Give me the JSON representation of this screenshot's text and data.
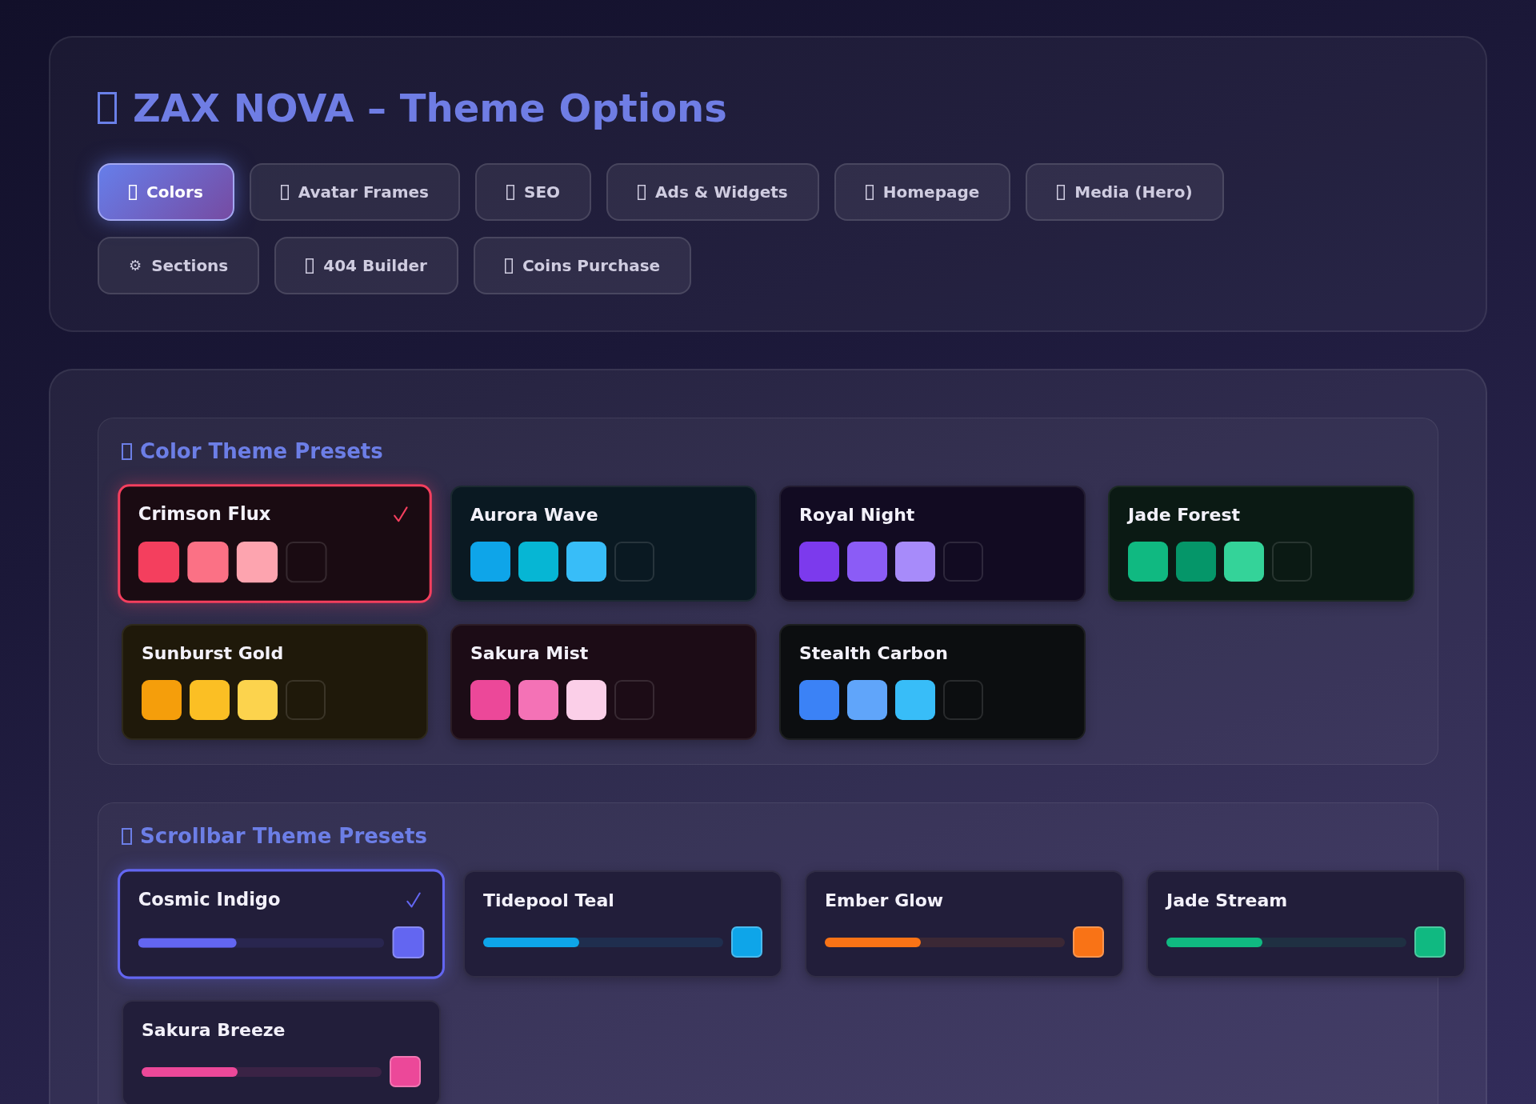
{
  "header": {
    "title": "ZAX NOVA – Theme Options"
  },
  "tabs": [
    {
      "label": "Colors",
      "selected": true
    },
    {
      "label": "Avatar Frames",
      "selected": false
    },
    {
      "label": "SEO",
      "selected": false
    },
    {
      "label": "Ads & Widgets",
      "selected": false
    },
    {
      "label": "Homepage",
      "selected": false
    },
    {
      "label": "Media (Hero)",
      "selected": false
    },
    {
      "label": "Sections",
      "selected": false,
      "glyph": "⚙"
    },
    {
      "label": "404 Builder",
      "selected": false
    },
    {
      "label": "Coins Purchase",
      "selected": false
    }
  ],
  "color_presets": {
    "heading": "Color Theme Presets",
    "items": [
      {
        "name": "Crimson Flux",
        "selected": true,
        "swatches": [
          {
            "color": "#f43f5e"
          },
          {
            "color": "#fb7185"
          },
          {
            "color": "#fda4af"
          },
          {
            "color": "#1a0b12"
          }
        ]
      },
      {
        "name": "Aurora Wave",
        "selected": false,
        "swatches": [
          {
            "color": "#0ea5e9"
          },
          {
            "color": "#06b6d4"
          },
          {
            "color": "#38bdf8"
          },
          {
            "color": "#0a1922"
          }
        ]
      },
      {
        "name": "Royal Night",
        "selected": false,
        "swatches": [
          {
            "color": "#7c3aed"
          },
          {
            "color": "#8b5cf6"
          },
          {
            "color": "#a78bfa"
          },
          {
            "color": "#120b22"
          }
        ]
      },
      {
        "name": "Jade Forest",
        "selected": false,
        "swatches": [
          {
            "color": "#10b981"
          },
          {
            "color": "#059669"
          },
          {
            "color": "#34d399"
          },
          {
            "color": "#0b1a14"
          }
        ]
      },
      {
        "name": "Sunburst Gold",
        "selected": false,
        "swatches": [
          {
            "color": "#f59e0b"
          },
          {
            "color": "#fbbf24"
          },
          {
            "color": "#fcd34d"
          },
          {
            "color": "#1f190a"
          }
        ]
      },
      {
        "name": "Sakura Mist",
        "selected": false,
        "swatches": [
          {
            "color": "#ec4899"
          },
          {
            "color": "#f472b6"
          },
          {
            "color": "#fbcfe8"
          },
          {
            "color": "#1c0c16"
          }
        ]
      },
      {
        "name": "Stealth Carbon",
        "selected": false,
        "swatches": [
          {
            "color": "#3b82f6"
          },
          {
            "color": "#60a5fa"
          },
          {
            "color": "#38bdf8"
          },
          {
            "color": "#0c0e10"
          }
        ]
      }
    ]
  },
  "scrollbar_presets": {
    "heading": "Scrollbar Theme Presets",
    "items": [
      {
        "name": "Cosmic Indigo",
        "selected": true,
        "color": "#6366f1"
      },
      {
        "name": "Tidepool Teal",
        "selected": false,
        "color": "#0ea5e9"
      },
      {
        "name": "Ember Glow",
        "selected": false,
        "color": "#f97316"
      },
      {
        "name": "Jade Stream",
        "selected": false,
        "color": "#10b981"
      },
      {
        "name": "Sakura Breeze",
        "selected": false,
        "color": "#ec4899"
      }
    ]
  }
}
